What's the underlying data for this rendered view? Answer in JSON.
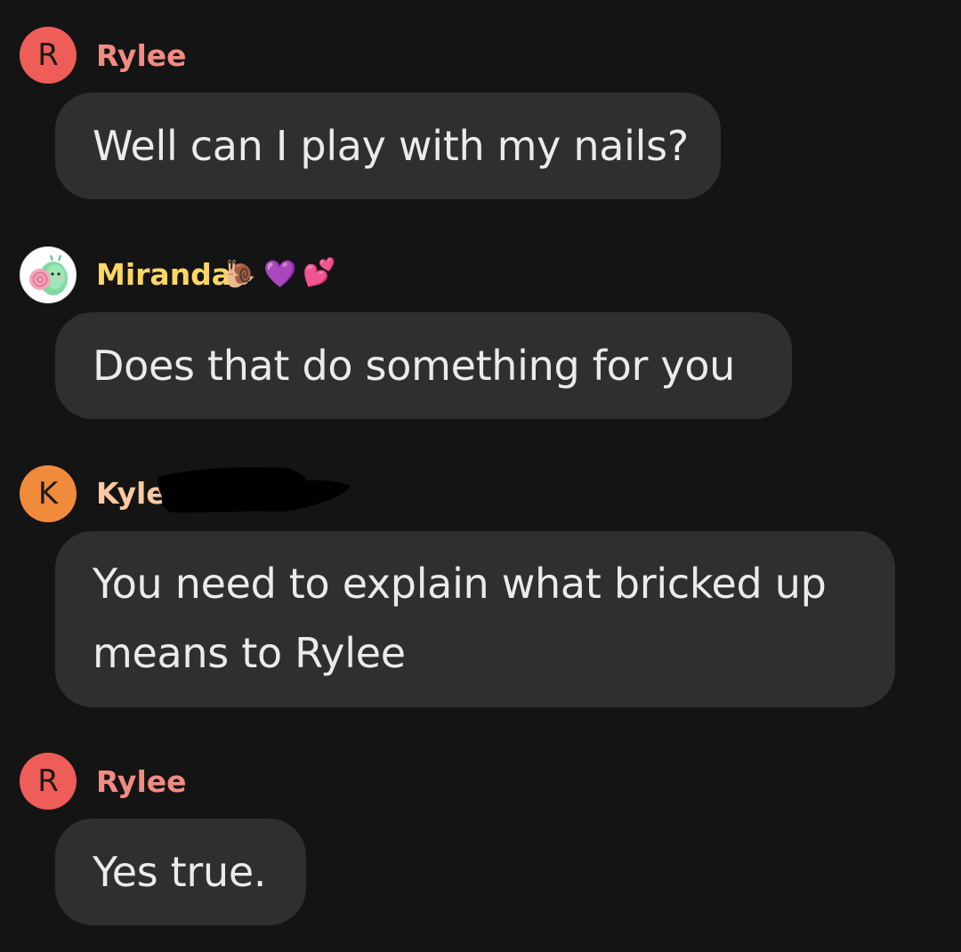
{
  "messages": [
    {
      "avatar_letter": "R",
      "avatar_color": "#ee5d57",
      "sender": "Rylee",
      "sender_color": "#f28b82",
      "text": "Well can I play with my nails?"
    },
    {
      "avatar_icon": "snail-avatar-icon",
      "sender": "Miranda",
      "sender_color": "#fdd663",
      "sender_emojis": [
        "🐌",
        "💜",
        "💕"
      ],
      "text": "Does that do something for you"
    },
    {
      "avatar_letter": "K",
      "avatar_color": "#f08b3c",
      "sender": "Kyle",
      "sender_color": "#fcc9a0",
      "text": "You need to explain what bricked up means to Rylee"
    },
    {
      "avatar_letter": "R",
      "avatar_color": "#ee5d57",
      "sender": "Rylee",
      "sender_color": "#f28b82",
      "text": "Yes true."
    }
  ],
  "colors": {
    "background": "#141414",
    "bubble": "#2f2f2f",
    "text": "#ebebeb"
  }
}
